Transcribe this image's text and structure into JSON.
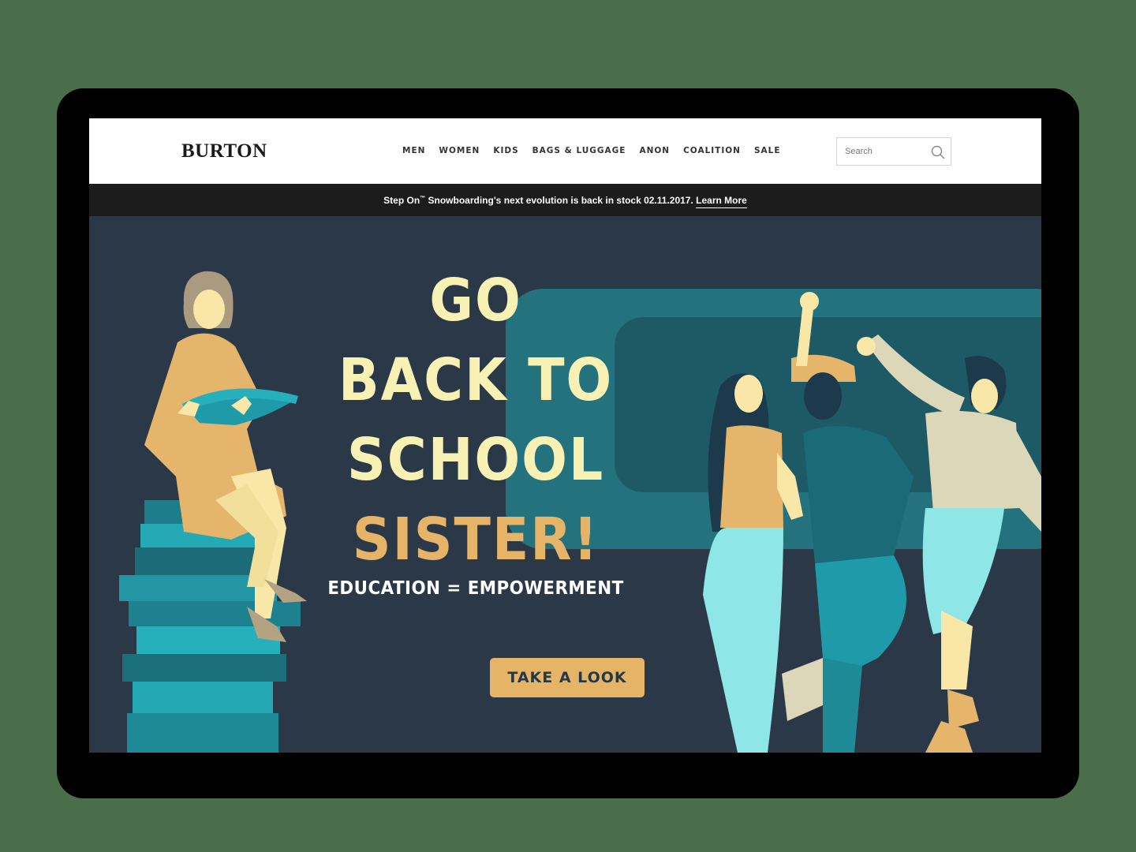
{
  "header": {
    "logo": "BURTON",
    "nav": [
      "MEN",
      "WOMEN",
      "KIDS",
      "BAGS & LUGGAGE",
      "ANON",
      "COALITION",
      "SALE"
    ],
    "search_placeholder": "Search"
  },
  "announcement": {
    "text_before_tm": "Step On",
    "trademark": "™",
    "text_after_tm": " Snowboarding's next evolution is back in stock 02.11.2017. ",
    "link": "Learn More"
  },
  "hero": {
    "headline_lines": [
      "GO",
      "BACK TO",
      "SCHOOL",
      "SISTER!"
    ],
    "tagline": "EDUCATION = EMPOWERMENT",
    "cta": "TAKE A LOOK"
  },
  "colors": {
    "hero_background": "#2b3848",
    "headline": "#f7f1b4",
    "accent": "#e5b466",
    "teal": "#1e9aa8",
    "announcement_bar": "#1c1c1c"
  }
}
